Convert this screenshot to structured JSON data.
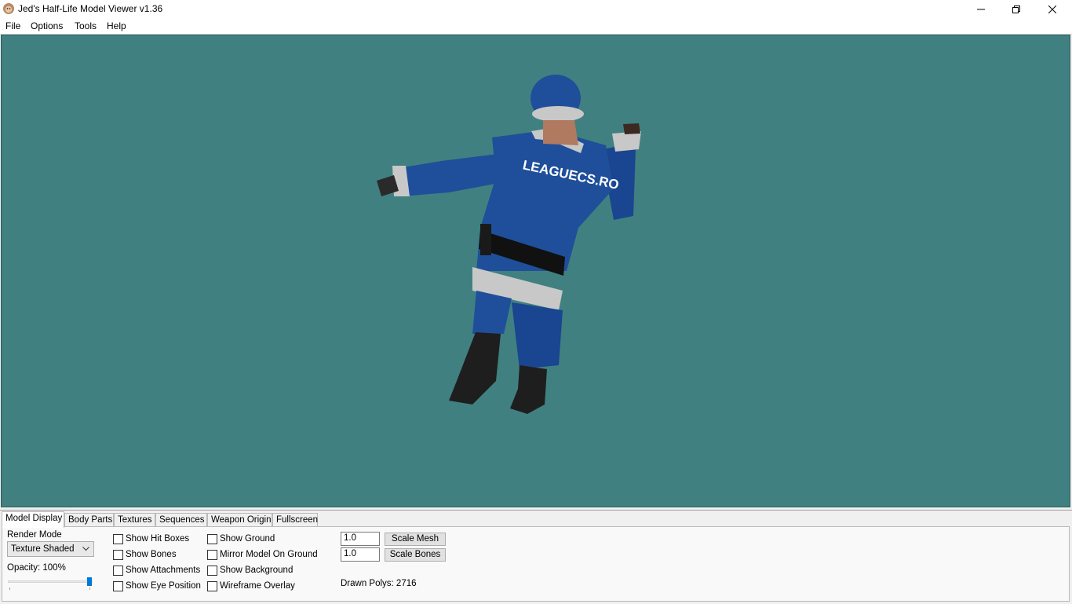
{
  "window": {
    "title": "Jed's Half-Life Model Viewer v1.36",
    "controls": [
      "minimize",
      "restore",
      "close"
    ]
  },
  "menu": [
    "File",
    "Options",
    "Tools",
    "Help"
  ],
  "viewport": {
    "background_color": "#418080",
    "model_text": "LEAGUECS.RO"
  },
  "tabs": [
    "Model Display",
    "Body Parts",
    "Textures",
    "Sequences",
    "Weapon Origin",
    "Fullscreen"
  ],
  "active_tab": "Model Display",
  "model_display": {
    "render_mode_label": "Render Mode",
    "render_mode_value": "Texture Shaded",
    "opacity_label": "Opacity: 100%",
    "opacity_value": 100,
    "checkboxes_col1": [
      {
        "label": "Show Hit Boxes",
        "checked": false
      },
      {
        "label": "Show Bones",
        "checked": false
      },
      {
        "label": "Show Attachments",
        "checked": false
      },
      {
        "label": "Show Eye Position",
        "checked": false
      }
    ],
    "checkboxes_col2": [
      {
        "label": "Show Ground",
        "checked": false
      },
      {
        "label": "Mirror Model On Ground",
        "checked": false
      },
      {
        "label": "Show Background",
        "checked": false
      },
      {
        "label": "Wireframe Overlay",
        "checked": false
      }
    ],
    "scale_mesh_value": "1.0",
    "scale_mesh_button": "Scale Mesh",
    "scale_bones_value": "1.0",
    "scale_bones_button": "Scale Bones",
    "drawn_polys": "Drawn Polys: 2716"
  },
  "colors": {
    "accent": "#0078d7",
    "suit_blue": "#1f4f9a",
    "fur_gray": "#c8c8c8"
  }
}
